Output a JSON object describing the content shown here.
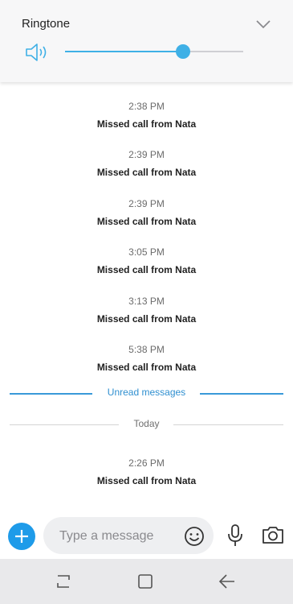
{
  "volume_panel": {
    "title": "Ringtone",
    "level": 0.66,
    "accent_color": "#3fb0e6",
    "icons": {
      "speaker": "speaker-icon",
      "collapse": "chevron-down-icon"
    }
  },
  "messages": [
    {
      "time": "2:38 PM",
      "text": "Missed call from Nata"
    },
    {
      "time": "2:39 PM",
      "text": "Missed call from Nata"
    },
    {
      "time": "2:39 PM",
      "text": "Missed call from Nata"
    },
    {
      "time": "3:05 PM",
      "text": "Missed call from Nata"
    },
    {
      "time": "3:13 PM",
      "text": "Missed call from Nata"
    },
    {
      "time": "5:38 PM",
      "text": "Missed call from Nata"
    },
    {
      "time": "2:26 PM",
      "text": "Missed call from Nata"
    }
  ],
  "dividers": {
    "unread": "Unread messages",
    "today": "Today"
  },
  "compose": {
    "placeholder": "Type a message",
    "accent_color": "#1e9be9",
    "icons": {
      "add": "plus-icon",
      "emoji": "emoji-icon",
      "mic": "mic-icon",
      "camera": "camera-icon"
    }
  },
  "nav_bar": {
    "icons": [
      "recents-icon",
      "home-icon",
      "back-icon"
    ]
  }
}
